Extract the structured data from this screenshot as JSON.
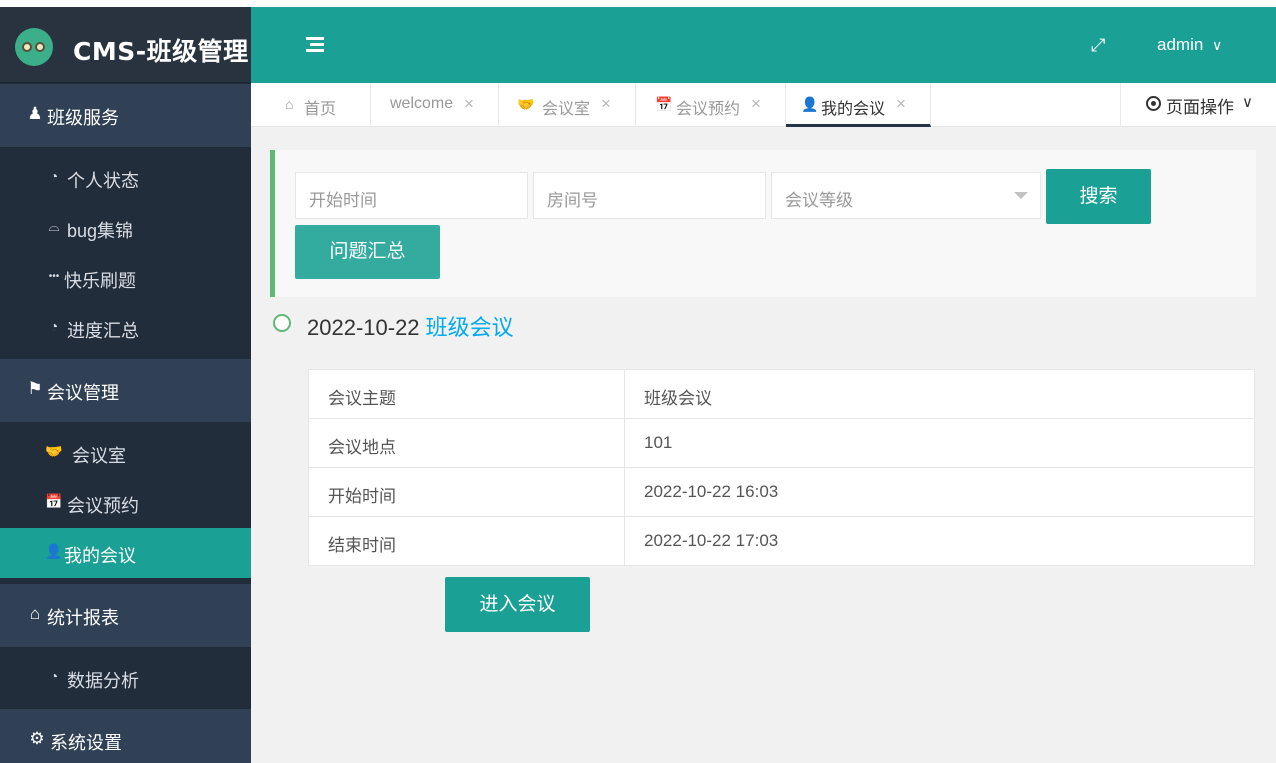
{
  "app": {
    "title": "CMS-班级管理",
    "accent_color": "#1aa094",
    "sidebar_color": "#222d3c"
  },
  "sidebar": {
    "groups": [
      {
        "label": "班级服务",
        "icon": "user-icon"
      },
      {
        "label": "会议管理",
        "icon": "flag-icon"
      },
      {
        "label": "统计报表",
        "icon": "home-icon"
      },
      {
        "label": "系统设置",
        "icon": "gears-icon"
      }
    ],
    "items": [
      {
        "label": "个人状态",
        "icon": "dashboard-icon"
      },
      {
        "label": "bug集锦",
        "icon": "bug-icon"
      },
      {
        "label": "快乐刷题",
        "icon": "ellipsis-icon"
      },
      {
        "label": "进度汇总",
        "icon": "dashboard-icon"
      },
      {
        "label": "会议室",
        "icon": "handshake-icon"
      },
      {
        "label": "会议预约",
        "icon": "calendar-plus-icon"
      },
      {
        "label": "我的会议",
        "icon": "user-outline-icon",
        "active": true
      },
      {
        "label": "数据分析",
        "icon": "dashboard-icon"
      }
    ]
  },
  "header": {
    "user": "admin",
    "user_caret": "∨",
    "fullscreen_glyph": "⤢",
    "page_ops_label": "页面操作",
    "page_ops_caret": "∨"
  },
  "tabs": [
    {
      "label": "首页",
      "icon": "home-icon",
      "closable": false
    },
    {
      "label": "welcome",
      "closable": true
    },
    {
      "label": "会议室",
      "icon": "handshake-icon",
      "closable": true
    },
    {
      "label": "会议预约",
      "icon": "calendar-plus-icon",
      "closable": true
    },
    {
      "label": "我的会议",
      "icon": "user-outline-icon",
      "closable": true,
      "active": true
    }
  ],
  "icons": {
    "close": "×",
    "home": "⌂",
    "handshake": "🤝",
    "calendar": "📅",
    "user_outline": "👤",
    "user": "♟",
    "flag": "⚑",
    "gears": "⚙",
    "dashboard": "◔",
    "bug": "⌓",
    "ellipsis": "•••"
  },
  "search": {
    "start_time_placeholder": "开始时间",
    "room_placeholder": "房间号",
    "level_placeholder": "会议等级",
    "search_label": "搜索",
    "summary_label": "问题汇总"
  },
  "meeting": {
    "date": "2022-10-22",
    "title": "班级会议",
    "rows": [
      {
        "key": "会议主题",
        "value": "班级会议"
      },
      {
        "key": "会议地点",
        "value": "101"
      },
      {
        "key": "开始时间",
        "value": "2022-10-22 16:03"
      },
      {
        "key": "结束时间",
        "value": "2022-10-22 17:03"
      }
    ],
    "enter_label": "进入会议"
  }
}
